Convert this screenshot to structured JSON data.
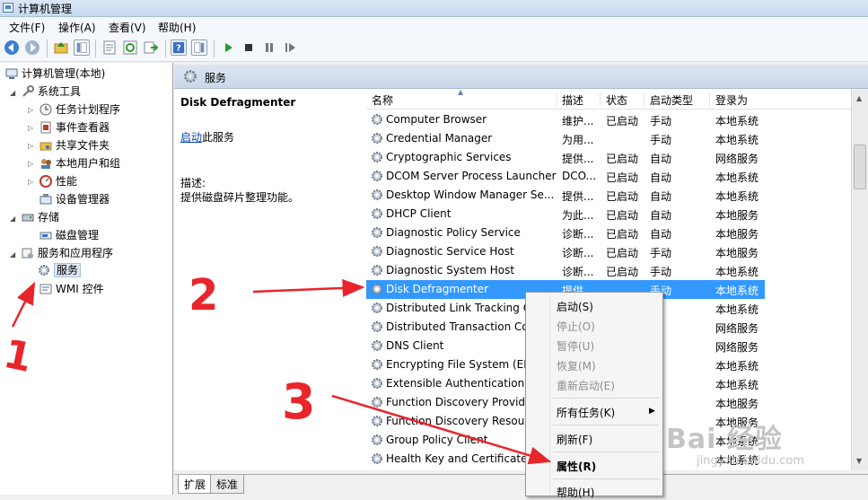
{
  "window": {
    "title": "计算机管理"
  },
  "menu": {
    "items": [
      "文件(F)",
      "操作(A)",
      "查看(V)",
      "帮助(H)"
    ]
  },
  "tree": {
    "root": "计算机管理(本地)",
    "system_tools": "系统工具",
    "task_scheduler": "任务计划程序",
    "event_viewer": "事件查看器",
    "shared_folders": "共享文件夹",
    "local_users": "本地用户和组",
    "performance": "性能",
    "device_manager": "设备管理器",
    "storage": "存储",
    "disk_management": "磁盘管理",
    "services_apps": "服务和应用程序",
    "services": "服务",
    "wmi": "WMI 控件"
  },
  "panel": {
    "header": "服务"
  },
  "details": {
    "service_name": "Disk Defragmenter",
    "start_link": "启动",
    "start_suffix": "此服务",
    "desc_label": "描述:",
    "desc_text": "提供磁盘碎片整理功能。"
  },
  "columns": {
    "name": "名称",
    "desc": "描述",
    "status": "状态",
    "startup": "启动类型",
    "logon": "登录为"
  },
  "services": [
    {
      "name": "Computer Browser",
      "desc": "维护...",
      "status": "已启动",
      "startup": "手动",
      "logon": "本地系统"
    },
    {
      "name": "Credential Manager",
      "desc": "为用...",
      "status": "",
      "startup": "手动",
      "logon": "本地系统"
    },
    {
      "name": "Cryptographic Services",
      "desc": "提供...",
      "status": "已启动",
      "startup": "自动",
      "logon": "网络服务"
    },
    {
      "name": "DCOM Server Process Launcher",
      "desc": "DCO...",
      "status": "已启动",
      "startup": "自动",
      "logon": "本地系统"
    },
    {
      "name": "Desktop Window Manager Se...",
      "desc": "提供...",
      "status": "已启动",
      "startup": "自动",
      "logon": "本地系统"
    },
    {
      "name": "DHCP Client",
      "desc": "为此...",
      "status": "已启动",
      "startup": "自动",
      "logon": "本地服务"
    },
    {
      "name": "Diagnostic Policy Service",
      "desc": "诊断...",
      "status": "已启动",
      "startup": "自动",
      "logon": "本地服务"
    },
    {
      "name": "Diagnostic Service Host",
      "desc": "诊断...",
      "status": "已启动",
      "startup": "手动",
      "logon": "本地服务"
    },
    {
      "name": "Diagnostic System Host",
      "desc": "诊断...",
      "status": "已启动",
      "startup": "手动",
      "logon": "本地系统"
    },
    {
      "name": "Disk Defragmenter",
      "desc": "提供...",
      "status": "",
      "startup": "手动",
      "logon": "本地系统"
    },
    {
      "name": "Distributed Link Tracking C",
      "desc": "",
      "status": "",
      "startup": "",
      "logon": "本地系统"
    },
    {
      "name": "Distributed Transaction Co",
      "desc": "",
      "status": "",
      "startup": "",
      "logon": "网络服务"
    },
    {
      "name": "DNS Client",
      "desc": "",
      "status": "",
      "startup": "",
      "logon": "网络服务"
    },
    {
      "name": "Encrypting File System (EFS",
      "desc": "",
      "status": "",
      "startup": "",
      "logon": "本地系统"
    },
    {
      "name": "Extensible Authentication P",
      "desc": "",
      "status": "",
      "startup": "",
      "logon": "本地系统"
    },
    {
      "name": "Function Discovery Provide",
      "desc": "",
      "status": "",
      "startup": "",
      "logon": "本地服务"
    },
    {
      "name": "Function Discovery Resourc",
      "desc": "",
      "status": "",
      "startup": "",
      "logon": "本地服务"
    },
    {
      "name": "Group Policy Client",
      "desc": "",
      "status": "",
      "startup": "",
      "logon": "本地系统"
    },
    {
      "name": "Health Key and Certificate",
      "desc": "",
      "status": "",
      "startup": "",
      "logon": "本地系统"
    }
  ],
  "context_menu": {
    "start": "启动(S)",
    "stop": "停止(O)",
    "pause": "暂停(U)",
    "resume": "恢复(M)",
    "restart": "重新启动(E)",
    "all_tasks": "所有任务(K)",
    "refresh": "刷新(F)",
    "properties": "属性(R)",
    "help": "帮助(H)"
  },
  "tabs": {
    "extended": "扩展",
    "standard": "标准"
  },
  "annotations": {
    "one": "1",
    "two": "2",
    "three": "3"
  },
  "watermark": {
    "brand": "Bai 经验",
    "url": "jingyan.baidu.com"
  },
  "colors": {
    "selection": "#3399ff",
    "annotation": "#e8252b",
    "link": "#0645ad"
  }
}
